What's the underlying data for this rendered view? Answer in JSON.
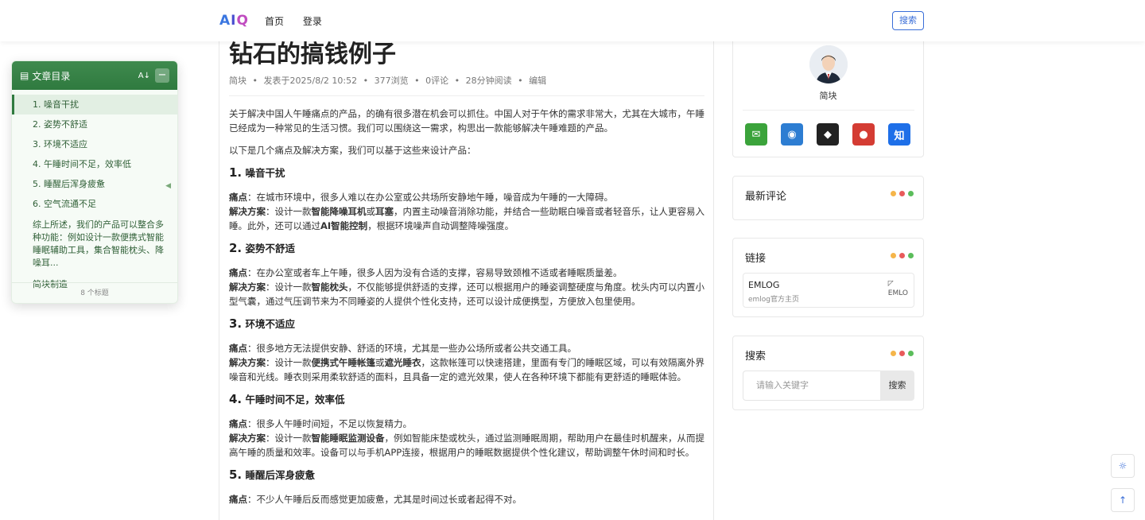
{
  "header": {
    "logo": {
      "a": "A",
      "i": "I",
      "o": "Q"
    },
    "nav": [
      "首页",
      "登录"
    ],
    "search_button": "搜索"
  },
  "toc": {
    "icon": "document-icon",
    "title": "文章目录",
    "sort_icon": "A↓",
    "collapse_label": "−",
    "items": [
      "1. 噪音干扰",
      "2. 姿势不舒适",
      "3. 环境不适应",
      "4. 午睡时间不足，效率低",
      "5. 睡醒后浑身疲惫",
      "6. 空气流通不足",
      "综上所述，我们的产品可以整合多种功能：例如设计一款便携式智能睡眠辅助工具，集合智能枕头、降噪耳...",
      "简块制造"
    ],
    "footer": "8 个标题",
    "accent_color": "#2f7a3f"
  },
  "article": {
    "title": "钻石的搞钱例子",
    "meta": [
      "简块",
      "•",
      "发表于2025/8/2 10:52",
      "•",
      "377浏览",
      "•",
      "0评论",
      "•",
      "28分钟阅读",
      "•",
      "编辑"
    ],
    "intro": "关于解决中国人午睡痛点的产品，的确有很多潜在机会可以抓住。中国人对于午休的需求非常大，尤其在大城市，午睡已经成为一种常见的生活习惯。我们可以围绕这一需求，构思出一款能够解决午睡难题的产品。",
    "lead": "以下是几个痛点及解决方案，我们可以基于这些来设计产品：",
    "sections": [
      {
        "num": "1.",
        "heading": "噪音干扰",
        "pain_label": "痛点",
        "pain": "：在城市环境中，很多人难以在办公室或公共场所安静地午睡，噪音成为午睡的一大障碍。",
        "sol_label": "解决方案",
        "sol_a": "：设计一款",
        "sol_b1": "智能降噪耳机",
        "sol_c": "或",
        "sol_b2": "耳塞",
        "sol_d": "，内置主动噪音消除功能，并结合一些助眠白噪音或者轻音乐，让人更容易入睡。此外，还可以通过",
        "sol_b3": "AI智能控制",
        "sol_e": "，根据环境噪声自动调整降噪强度。"
      },
      {
        "num": "2.",
        "heading": "姿势不舒适",
        "pain_label": "痛点",
        "pain": "：在办公室或者车上午睡，很多人因为没有合适的支撑，容易导致颈椎不适或者睡眠质量差。",
        "sol_label": "解决方案",
        "sol_a": "：设计一款",
        "sol_b1": "智能枕头",
        "sol_c": "，不仅能够提供舒适的支撑，还可以根据用户的睡姿调整硬度与角度。枕头内可以内置小型气囊，通过气压调节来为不同睡姿的人提供个性化支持，还可以设计成便携型，方便放入包里使用。"
      },
      {
        "num": "3.",
        "heading": "环境不适应",
        "pain_label": "痛点",
        "pain": "：很多地方无法提供安静、舒适的环境，尤其是一些办公场所或者公共交通工具。",
        "sol_label": "解决方案",
        "sol_a": "：设计一款",
        "sol_b1": "便携式午睡帐篷",
        "sol_c": "或",
        "sol_b2": "遮光睡衣",
        "sol_d": "，这款帐篷可以快速搭建，里面有专门的睡眠区域，可以有效隔离外界噪音和光线。睡衣则采用柔软舒适的面料，且具备一定的遮光效果，使人在各种环境下都能有更舒适的睡眠体验。"
      },
      {
        "num": "4.",
        "heading": "午睡时间不足，效率低",
        "pain_label": "痛点",
        "pain": "：很多人午睡时间短，不足以恢复精力。",
        "sol_label": "解决方案",
        "sol_a": "：设计一款",
        "sol_b1": "智能睡眠监测设备",
        "sol_c": "，例如智能床垫或枕头，通过监测睡眠周期，帮助用户在最佳时机醒来，从而提高午睡的质量和效率。设备可以与手机APP连接，根据用户的睡眠数据提供个性化建议，帮助调整午休时间和时长。"
      },
      {
        "num": "5.",
        "heading": "睡醒后浑身疲惫",
        "pain_label": "痛点",
        "pain": "：不少人午睡后反而感觉更加疲惫，尤其是时间过长或者起得不对。"
      }
    ]
  },
  "profile": {
    "name": "简块",
    "socials": [
      {
        "icon": "wechat-icon",
        "glyph": "✉",
        "color": "#3ba33b"
      },
      {
        "icon": "qq-icon",
        "glyph": "◉",
        "color": "#2d7dd2"
      },
      {
        "icon": "github-icon",
        "glyph": "◆",
        "color": "#222222"
      },
      {
        "icon": "weibo-icon",
        "glyph": "●",
        "color": "#d43c33"
      },
      {
        "icon": "zhihu-icon",
        "glyph": "知",
        "color": "#1e6fe8"
      }
    ]
  },
  "widgets": {
    "comments_title": "最新评论",
    "links_title": "链接",
    "link": {
      "name": "EMLOG",
      "desc": "emlog官方主页",
      "img_alt": "EMLO"
    },
    "search_title": "搜索",
    "search_placeholder": "请输入关键字",
    "search_button": "搜索",
    "dot_colors": [
      "#f5b54a",
      "#e85b5b",
      "#5bbd5b"
    ]
  },
  "floating": {
    "theme_icon": "sun-icon",
    "theme_glyph": "☼",
    "top_icon": "arrow-up-icon",
    "top_glyph": "↑"
  }
}
